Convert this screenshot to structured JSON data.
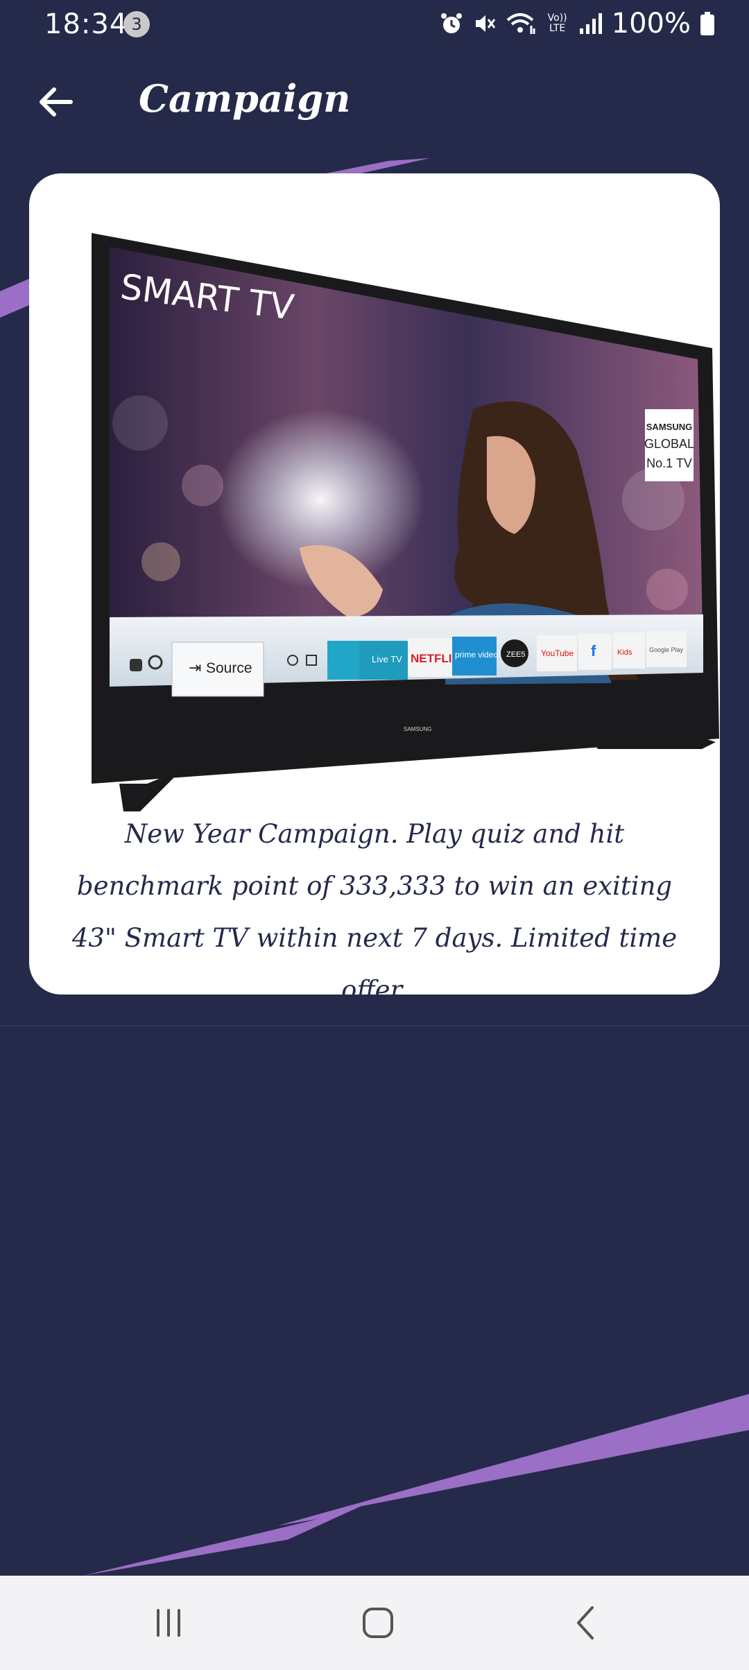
{
  "status_bar": {
    "time": "18:34",
    "notification_count": "3",
    "battery": "100%",
    "icons": [
      "alarm-icon",
      "mute-icon",
      "wifi-icon",
      "volte-icon",
      "signal-icon",
      "battery-icon"
    ],
    "volte_label": "Vo)) LTE"
  },
  "header": {
    "title": "Campaign",
    "back_icon": "arrow-left-icon"
  },
  "campaign": {
    "tv_screen_text": "SMART TV",
    "badge_lines": [
      "SAMSUNG",
      "GLOBAL",
      "No.1 TV"
    ],
    "source_label": "Source",
    "app_tiles": [
      "Live TV",
      "NETFLIX",
      "prime video",
      "ZEE5",
      "YouTube",
      "f",
      "Kids",
      "Google Play"
    ],
    "brand_label": "SAMSUNG",
    "description": "New Year Campaign. Play quiz and hit benchmark point of 333,333 to win an exiting 43\" Smart TV within next 7 days. Limited time offer."
  },
  "colors": {
    "background": "#252a4a",
    "accent_stripe": "#9b6fc6",
    "card": "#ffffff",
    "nav_bar": "#f3f3f5"
  },
  "nav_bar": {
    "buttons": [
      "recents-icon",
      "home-icon",
      "back-icon"
    ]
  }
}
